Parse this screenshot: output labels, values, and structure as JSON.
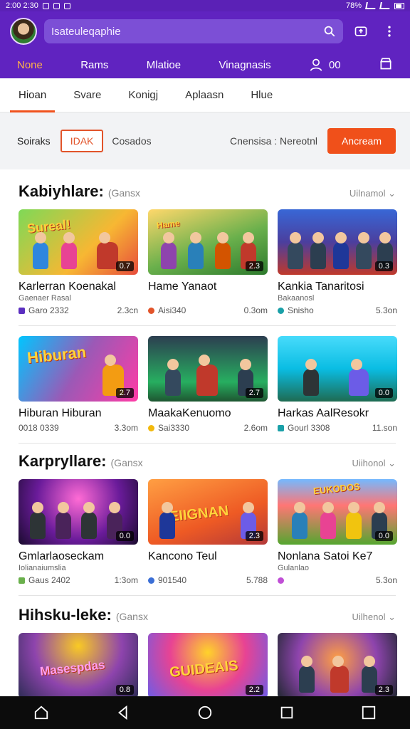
{
  "status": {
    "time": "2:00 2:30",
    "right": "78%"
  },
  "search": {
    "text": "Isateuleqaphie"
  },
  "nav": {
    "items": [
      "None",
      "Rams",
      "Mlatioe",
      "Vinagnasis"
    ],
    "user_count": "00"
  },
  "tabs": [
    "Hioan",
    "Svare",
    "Konigj",
    "Aplaasn",
    "Hlue"
  ],
  "filter": {
    "label": "Soiraks",
    "chip": "IDAK",
    "text": "Cosados",
    "sort": "Cnensisa : Nereotnl",
    "button": "Ancream"
  },
  "sections": [
    {
      "title": "Kabiyhlare:",
      "hint": "(Gansx",
      "more": "Uilnamol ⌄",
      "rows": [
        [
          {
            "title": "Karlerran Koenakal",
            "sub": "Gaenaer Rasal",
            "meta_left": "Garo 2332",
            "meta_right": "2.3cn",
            "badge": "0.7",
            "dot": "#5b2fc0"
          },
          {
            "title": "Hame Yanaot",
            "sub": "",
            "meta_left": "Aisi340",
            "meta_right": "0.3om",
            "badge": "2.3",
            "dot": "#e2542a"
          },
          {
            "title": "Kankia Tanaritosi",
            "sub": "Bakaanosl",
            "meta_left": "Snisho",
            "meta_right": "5.3on",
            "badge": "0.3",
            "dot": "#1aa0a8"
          }
        ],
        [
          {
            "title": "Hiburan Hiburan",
            "sub": "",
            "meta_left": "0018 0339",
            "meta_right": "3.3om",
            "badge": "2.7",
            "dot": ""
          },
          {
            "title": "MaakaKenuomo",
            "sub": "",
            "meta_left": "Sai3330",
            "meta_right": "2.6om",
            "badge": "2.7",
            "dot": "#f2b90c"
          },
          {
            "title": "Harkas AalResokr",
            "sub": "",
            "meta_left": "Gourl 3308",
            "meta_right": "11.son",
            "badge": "0.0",
            "dot": "#1aa0a8"
          }
        ]
      ]
    },
    {
      "title": "Karpryllare:",
      "hint": "(Gansx",
      "more": "Uiihonol ⌄",
      "rows": [
        [
          {
            "title": "Gmlarlaoseckam",
            "sub": "Iolianaiumslia",
            "meta_left": "Gaus 2402",
            "meta_right": "1:3om",
            "badge": "0.0",
            "dot": "#6ab04c"
          },
          {
            "title": "Kancono Teul",
            "sub": "",
            "meta_left": "901540",
            "meta_right": "5.788",
            "badge": "2.3",
            "dot": "#3b6fd6"
          },
          {
            "title": "Nonlana Satoi Ke7",
            "sub": "Gulanlao",
            "meta_left": "",
            "meta_right": "5.3on",
            "badge": "0.0",
            "dot": "#c04fd6"
          }
        ]
      ]
    },
    {
      "title": "Hihsku-leke:",
      "hint": "(Gansx",
      "more": "Uilhenol ⌄",
      "rows": [
        [
          {
            "title": "",
            "sub": "",
            "meta_left": "",
            "meta_right": "",
            "badge": "0.8",
            "dot": ""
          },
          {
            "title": "",
            "sub": "",
            "meta_left": "",
            "meta_right": "",
            "badge": "2.2",
            "dot": ""
          },
          {
            "title": "",
            "sub": "",
            "meta_left": "",
            "meta_right": "",
            "badge": "2.3",
            "dot": ""
          }
        ]
      ]
    }
  ],
  "colors": {
    "brand": "#6023c0",
    "accent": "#f0501a",
    "active_nav": "#ffb347"
  }
}
